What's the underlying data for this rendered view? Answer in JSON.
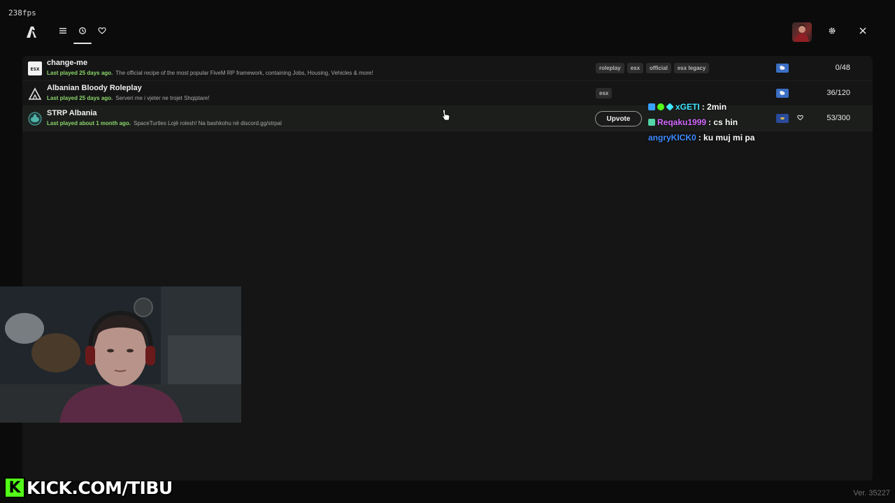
{
  "overlay": {
    "fps": "238fps"
  },
  "topbar": {
    "nav": [
      {
        "icon": "menu-icon"
      },
      {
        "icon": "history-icon",
        "active": true
      },
      {
        "icon": "heart-icon"
      }
    ],
    "right_icons": [
      "settings-icon",
      "close-icon"
    ]
  },
  "servers": [
    {
      "name": "change-me",
      "last_played": "Last played 25 days ago.",
      "description": "The official recipe of the most popular FiveM RP framework, containing Jobs, Housing, Vehicles & more!",
      "tags": [
        "roleplay",
        "esx",
        "official",
        "esx legacy"
      ],
      "players": "0/48",
      "icon": "esx-logo-icon"
    },
    {
      "name": "Albanian Bloody Roleplay",
      "last_played": "Last played 25 days ago.",
      "description": "Serveri me i vjeter ne trojet Shqiptare!",
      "tags": [
        "esx"
      ],
      "players": "36/120",
      "icon": "fivem-logo-icon"
    },
    {
      "name": "STRP Albania",
      "last_played": "Last played about 1 month ago.",
      "description": "SpaceTurtles Lojë rolesh! Na bashkohu në discord.gg/strpal",
      "upvote_label": "Upvote",
      "players": "53/300",
      "icon": "turtle-logo-icon"
    }
  ],
  "chat": [
    {
      "user": "xGETI",
      "text": ": 2min",
      "color": "#3ee8ff"
    },
    {
      "user": "Reqaku1999",
      "text": ": cs hin",
      "color": "#d46bff"
    },
    {
      "user": "angryKICK0",
      "text": ": ku muj mi pa",
      "color": "#3d8bff"
    }
  ],
  "watermark": {
    "k": "K",
    "text": "KICK.COM/TIBU"
  },
  "version": "Ver. 35227",
  "colors": {
    "accent_green": "#8bd66b",
    "panel": "#151515",
    "background": "#0b0b0b"
  }
}
